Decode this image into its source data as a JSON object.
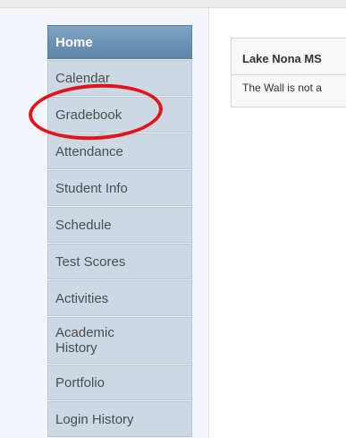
{
  "sidebar": {
    "items": [
      {
        "label": "Home"
      },
      {
        "label": "Calendar"
      },
      {
        "label": "Gradebook"
      },
      {
        "label": "Attendance"
      },
      {
        "label": "Student Info"
      },
      {
        "label": "Schedule"
      },
      {
        "label": "Test Scores"
      },
      {
        "label": "Activities"
      },
      {
        "label": "Academic History"
      },
      {
        "label": "Portfolio"
      },
      {
        "label": "Login History"
      }
    ]
  },
  "school_card": {
    "title": "Lake Nona MS",
    "message": "The Wall is not a"
  },
  "colors": {
    "active_nav": "#6b92b4",
    "nav_item": "#cbd9e5",
    "highlight_circle": "#e2141b"
  }
}
